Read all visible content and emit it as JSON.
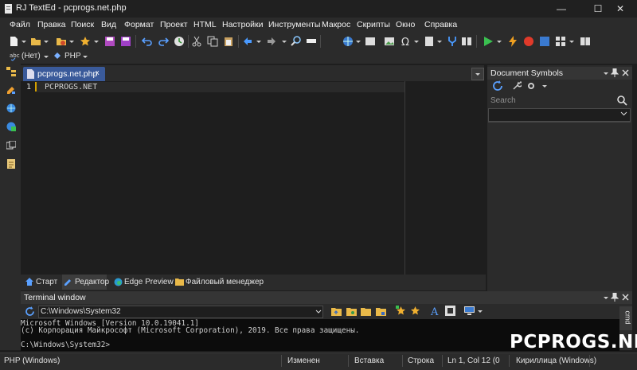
{
  "window": {
    "title": "RJ TextEd - pcprogs.net.php",
    "minimize_glyph": "—",
    "maximize_glyph": "☐",
    "close_glyph": "✕"
  },
  "menu": [
    {
      "label": "Файл"
    },
    {
      "label": "Правка"
    },
    {
      "label": "Поиск"
    },
    {
      "label": "Вид"
    },
    {
      "label": "Формат"
    },
    {
      "label": "Проект"
    },
    {
      "label": "HTML"
    },
    {
      "label": "Настройки"
    },
    {
      "label": "Инструменты"
    },
    {
      "label": "Макрос"
    },
    {
      "label": "Скрипты"
    },
    {
      "label": "Окно"
    },
    {
      "label": "Справка"
    }
  ],
  "toolbar2": {
    "spell_lang": "(Нет)",
    "syntax": "PHP"
  },
  "editor": {
    "tab_label": "pcprogs.net.php",
    "tab_close": "x",
    "line_number": "1",
    "code_line": "PCPROGS.NET"
  },
  "bottom_tabs": [
    {
      "label": "Старт",
      "icon": "home-icon"
    },
    {
      "label": "Редактор",
      "icon": "editor-icon"
    },
    {
      "label": "Edge Preview",
      "icon": "edge-icon"
    },
    {
      "label": "Файловый менеджер",
      "icon": "folder-icon"
    }
  ],
  "doc_symbols": {
    "title": "Document Symbols",
    "search_placeholder": "Search"
  },
  "terminal": {
    "title": "Terminal window",
    "path": "C:\\Windows\\System32",
    "lines": [
      "Microsoft Windows [Version 10.0.19041.1]",
      "(c) Корпорация Майкрософт (Microsoft Corporation), 2019. Все права защищены.",
      "",
      "C:\\Windows\\System32>"
    ],
    "side_tab": "cmd"
  },
  "status": {
    "language": "PHP (Windows)",
    "modified": "Изменен",
    "insert_mode": "Вставка",
    "mode": "Строка",
    "position": "Ln 1, Col 12 (0",
    "encoding": "Кириллица (Windows)"
  },
  "watermark": "PCPROGS.NET",
  "colors": {
    "accent_tab": "#3a5a9a",
    "background": "#1e1e1e",
    "panel": "#2b2b2b"
  }
}
